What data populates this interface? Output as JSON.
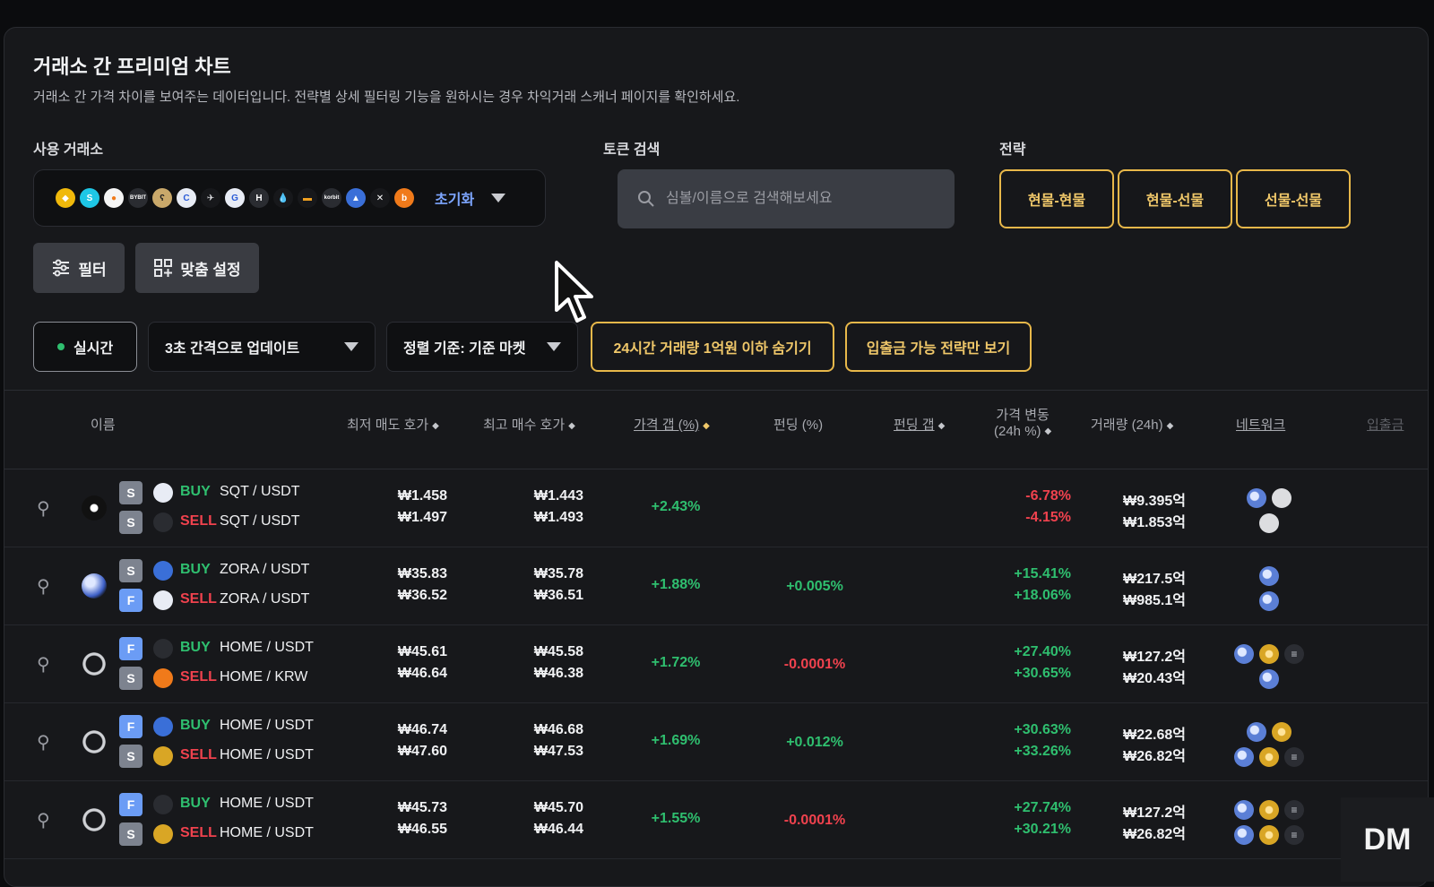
{
  "header": {
    "title": "거래소 간 프리미엄 차트",
    "subtitle": "거래소 간 가격 차이를 보여주는 데이터입니다. 전략별 상세 필터링 기능을 원하시는 경우 차익거래 스캐너 페이지를 확인하세요."
  },
  "exchanges": {
    "label": "사용 거래소",
    "reset_label": "초기화",
    "icons": [
      "binance-icon",
      "swap-icon",
      "bitget-icon",
      "bybit-icon",
      "bear-icon",
      "coinbase-icon",
      "bird-icon",
      "gate-icon",
      "htx-icon",
      "drop-icon",
      "sushi-icon",
      "korbit-icon",
      "upbit-icon",
      "x-icon",
      "bithumb-icon"
    ]
  },
  "search": {
    "label": "토큰 검색",
    "placeholder": "심볼/이름으로 검색해보세요"
  },
  "strategy": {
    "label": "전략",
    "options": [
      "현물-현물",
      "현물-선물",
      "선물-선물"
    ]
  },
  "toolbar": {
    "filter_label": "필터",
    "custom_label": "맞춤 설정",
    "realtime_label": "실시간",
    "interval_label": "3초 간격으로 업데이트",
    "sort_label": "정렬 기준: 기준 마켓",
    "hide_volume_label": "24시간 거래량 1억원 이하 숨기기",
    "transfer_only_label": "입출금 가능 전략만 보기"
  },
  "table": {
    "headers": {
      "name": "이름",
      "ask": "최저 매도 호가",
      "bid": "최고 매수 호가",
      "gap": "가격 갭 (%)",
      "funding": "펀딩 (%)",
      "funding_gap": "펀딩 갭",
      "change_1": "가격 변동",
      "change_2": "(24h %)",
      "volume": "거래량 (24h)",
      "network": "네트워크",
      "transfer": "입출금"
    },
    "rows": [
      {
        "buy_market": "S",
        "sell_market": "S",
        "buy_side": "BUY",
        "sell_side": "SELL",
        "buy_pair": "SQT / USDT",
        "sell_pair": "SQT / USDT",
        "ask_1": "₩1.458",
        "ask_2": "₩1.497",
        "bid_1": "₩1.443",
        "bid_2": "₩1.493",
        "gap": "+2.43%",
        "funding": "",
        "change_1": "-6.78%",
        "change_2": "-4.15%",
        "volume_1": "₩9.395억",
        "volume_2": "₩1.853억"
      },
      {
        "buy_market": "S",
        "sell_market": "F",
        "buy_side": "BUY",
        "sell_side": "SELL",
        "buy_pair": "ZORA / USDT",
        "sell_pair": "ZORA / USDT",
        "ask_1": "₩35.83",
        "ask_2": "₩36.52",
        "bid_1": "₩35.78",
        "bid_2": "₩36.51",
        "gap": "+1.88%",
        "funding": "+0.005%",
        "change_1": "+15.41%",
        "change_2": "+18.06%",
        "volume_1": "₩217.5억",
        "volume_2": "₩985.1억"
      },
      {
        "buy_market": "F",
        "sell_market": "S",
        "buy_side": "BUY",
        "sell_side": "SELL",
        "buy_pair": "HOME / USDT",
        "sell_pair": "HOME / KRW",
        "ask_1": "₩45.61",
        "ask_2": "₩46.64",
        "bid_1": "₩45.58",
        "bid_2": "₩46.38",
        "gap": "+1.72%",
        "funding": "-0.0001%",
        "change_1": "+27.40%",
        "change_2": "+30.65%",
        "volume_1": "₩127.2억",
        "volume_2": "₩20.43억"
      },
      {
        "buy_market": "F",
        "sell_market": "S",
        "buy_side": "BUY",
        "sell_side": "SELL",
        "buy_pair": "HOME / USDT",
        "sell_pair": "HOME / USDT",
        "ask_1": "₩46.74",
        "ask_2": "₩47.60",
        "bid_1": "₩46.68",
        "bid_2": "₩47.53",
        "gap": "+1.69%",
        "funding": "+0.012%",
        "change_1": "+30.63%",
        "change_2": "+33.26%",
        "volume_1": "₩22.68억",
        "volume_2": "₩26.82억"
      },
      {
        "buy_market": "F",
        "sell_market": "S",
        "buy_side": "BUY",
        "sell_side": "SELL",
        "buy_pair": "HOME / USDT",
        "sell_pair": "HOME / USDT",
        "ask_1": "₩45.73",
        "ask_2": "₩46.55",
        "bid_1": "₩45.70",
        "bid_2": "₩46.44",
        "gap": "+1.55%",
        "funding": "-0.0001%",
        "change_1": "+27.74%",
        "change_2": "+30.21%",
        "volume_1": "₩127.2억",
        "volume_2": "₩26.82억"
      }
    ]
  },
  "watermark": "DM",
  "colors": {
    "accent_gold": "#e8b84a",
    "positive": "#2fbf6f",
    "negative": "#f0424e",
    "link_blue": "#7da6ff"
  }
}
